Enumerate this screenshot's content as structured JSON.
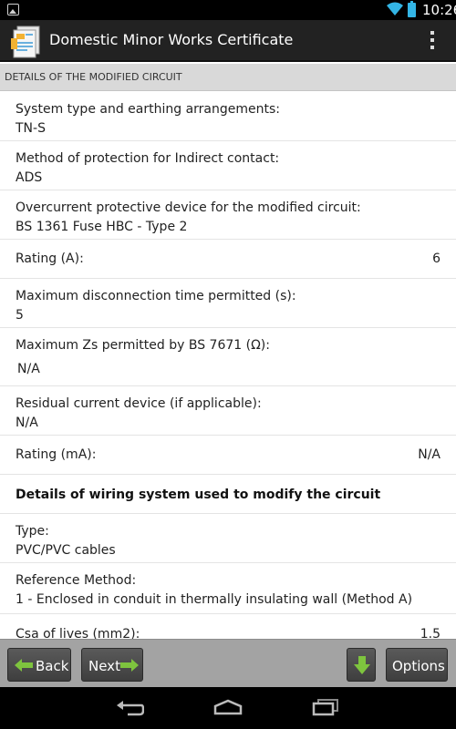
{
  "status_bar": {
    "time": "10:26"
  },
  "app_bar": {
    "title": "Domestic Minor Works Certificate"
  },
  "section_header": "DETAILS OF THE MODIFIED CIRCUIT",
  "fields": {
    "system_type": {
      "label": "System type and earthing arrangements:",
      "value": "TN-S"
    },
    "protection_method": {
      "label": "Method of protection for Indirect contact:",
      "value": "ADS"
    },
    "overcurrent_device": {
      "label": "Overcurrent protective device for the modified circuit:",
      "value": "BS 1361 Fuse HBC - Type 2"
    },
    "rating_a": {
      "label": "Rating (A):",
      "value": "6"
    },
    "max_disconnection": {
      "label": "Maximum disconnection time permitted (s):",
      "value": "5"
    },
    "max_zs": {
      "label": "Maximum Zs permitted by BS 7671 (Ω):",
      "value": "N/A"
    },
    "rcd": {
      "label": "Residual current device (if applicable):",
      "value": "N/A"
    },
    "rating_ma": {
      "label": "Rating (mA):",
      "value": "N/A"
    },
    "wiring_heading": "Details of wiring system used to modify the circuit",
    "type": {
      "label": "Type:",
      "value": "PVC/PVC cables"
    },
    "reference_method": {
      "label": "Reference Method:",
      "value": "1 - Enclosed in conduit in thermally insulating wall (Method A)"
    },
    "csa_lives": {
      "label": "Csa of lives (mm2):",
      "value": "1.5"
    }
  },
  "bottom_bar": {
    "back_label": "Back",
    "next_label": "Next",
    "options_label": "Options"
  },
  "colors": {
    "arrow_green": "#7ec43e",
    "accent_blue": "#33b5e5",
    "toolbar_gray": "#a3a3a3"
  },
  "icons": [
    "notification-image-icon",
    "wifi-icon",
    "battery-icon",
    "app-certificate-icon",
    "overflow-menu-icon",
    "arrow-left-icon",
    "arrow-right-icon",
    "save-download-icon",
    "nav-back-icon",
    "nav-home-icon",
    "nav-recents-icon"
  ]
}
